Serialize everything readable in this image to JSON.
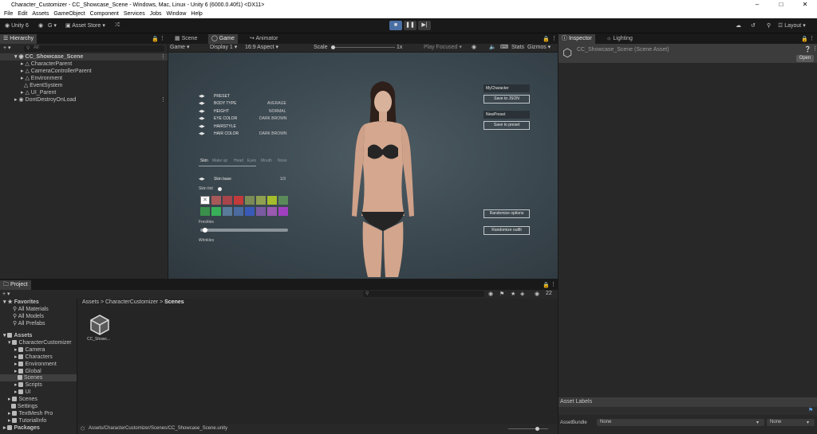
{
  "window": {
    "title": "Character_Customizer - CC_Showcase_Scene - Windows, Mac, Linux - Unity 6 (6000.0.40f1) <DX11>"
  },
  "menu": [
    "File",
    "Edit",
    "Assets",
    "GameObject",
    "Component",
    "Services",
    "Jobs",
    "Window",
    "Help"
  ],
  "toolbar": {
    "unity": "Unity 6",
    "account": "G",
    "asset_store": "Asset Store",
    "layout": "Layout"
  },
  "hierarchy": {
    "tab": "Hierarchy",
    "search_placeholder": "All",
    "scene": "CC_Showcase_Scene",
    "items": [
      "CharacterParent",
      "CameraControllerParent",
      "Environment",
      "EventSystem",
      "UI_Parent"
    ],
    "dontdestroy": "DontDestroyOnLoad"
  },
  "center_tabs": {
    "scene": "Scene",
    "game": "Game",
    "animator": "Animator"
  },
  "gamebar": {
    "mode": "Game",
    "display": "Display 1",
    "aspect": "16:9 Aspect",
    "scale_label": "Scale",
    "scale_value": "1x",
    "play_focused": "Play Focused",
    "stats": "Stats",
    "gizmos": "Gizmos"
  },
  "game_ui": {
    "rows": [
      {
        "label": "PRESET",
        "value": ""
      },
      {
        "label": "BODY TYPE",
        "value": "AVERAGE"
      },
      {
        "label": "HEIGHT",
        "value": "NORMAL"
      },
      {
        "label": "EYE COLOR",
        "value": "DARK BROWN"
      },
      {
        "label": "HAIRSTYLE",
        "value": ""
      },
      {
        "label": "HAIR COLOR",
        "value": "DARK BROWN"
      }
    ],
    "tabs": [
      "Skin",
      "Make up",
      "Head",
      "Eyes",
      "Mouth",
      "Nose"
    ],
    "skin_base_label": "Skin base",
    "skin_base_value": "1/3",
    "skin_tint_label": "Skin tint",
    "freckles_label": "Freckles",
    "freckles_value": 0.03,
    "wrinkles_label": "Wrinkles",
    "character_name": "MyCharacter",
    "save_json": "Save to JSON",
    "preset_name": "NewPreset",
    "save_preset": "Save to preset",
    "randomize_options": "Randomize options",
    "randomize_outfit": "Randomize outfit",
    "swatches": [
      "#ffffff",
      "#a85a5a",
      "#a8454b",
      "#c23a3a",
      "#7b8a56",
      "#8fa050",
      "#a5bd2c",
      "#5a8a5a",
      "#3a8f4a",
      "#38b05a",
      "#5a7a9a",
      "#4a6aa0",
      "#3a5ab8",
      "#7a5aa0",
      "#9a5ab0",
      "#a040c0"
    ]
  },
  "inspector": {
    "tab": "Inspector",
    "lighting_tab": "Lighting",
    "title": "CC_Showcase_Scene (Scene Asset)",
    "open": "Open",
    "asset_labels": "Asset Labels",
    "asset_bundle": "AssetBundle",
    "bundle_value": "None",
    "variant_value": "None"
  },
  "project": {
    "tab": "Project",
    "favorites_label": "Favorites",
    "favorites": [
      "All Materials",
      "All Models",
      "All Prefabs"
    ],
    "assets_label": "Assets",
    "cc_folder": "CharacterCustomizer",
    "subfolders": [
      "Camera",
      "Characters",
      "Environment",
      "Global",
      "Scenes",
      "Scripts",
      "UI"
    ],
    "root_folders": [
      "Scenes",
      "Settings",
      "TextMesh Pro",
      "TutorialInfo"
    ],
    "packages": "Packages",
    "breadcrumb": [
      "Assets",
      "CharacterCustomizer",
      "Scenes"
    ],
    "asset_name": "CC_Showc...",
    "path": "Assets/CharacterCustomizer/Scenes/CC_Showcase_Scene.unity",
    "count": "22"
  }
}
